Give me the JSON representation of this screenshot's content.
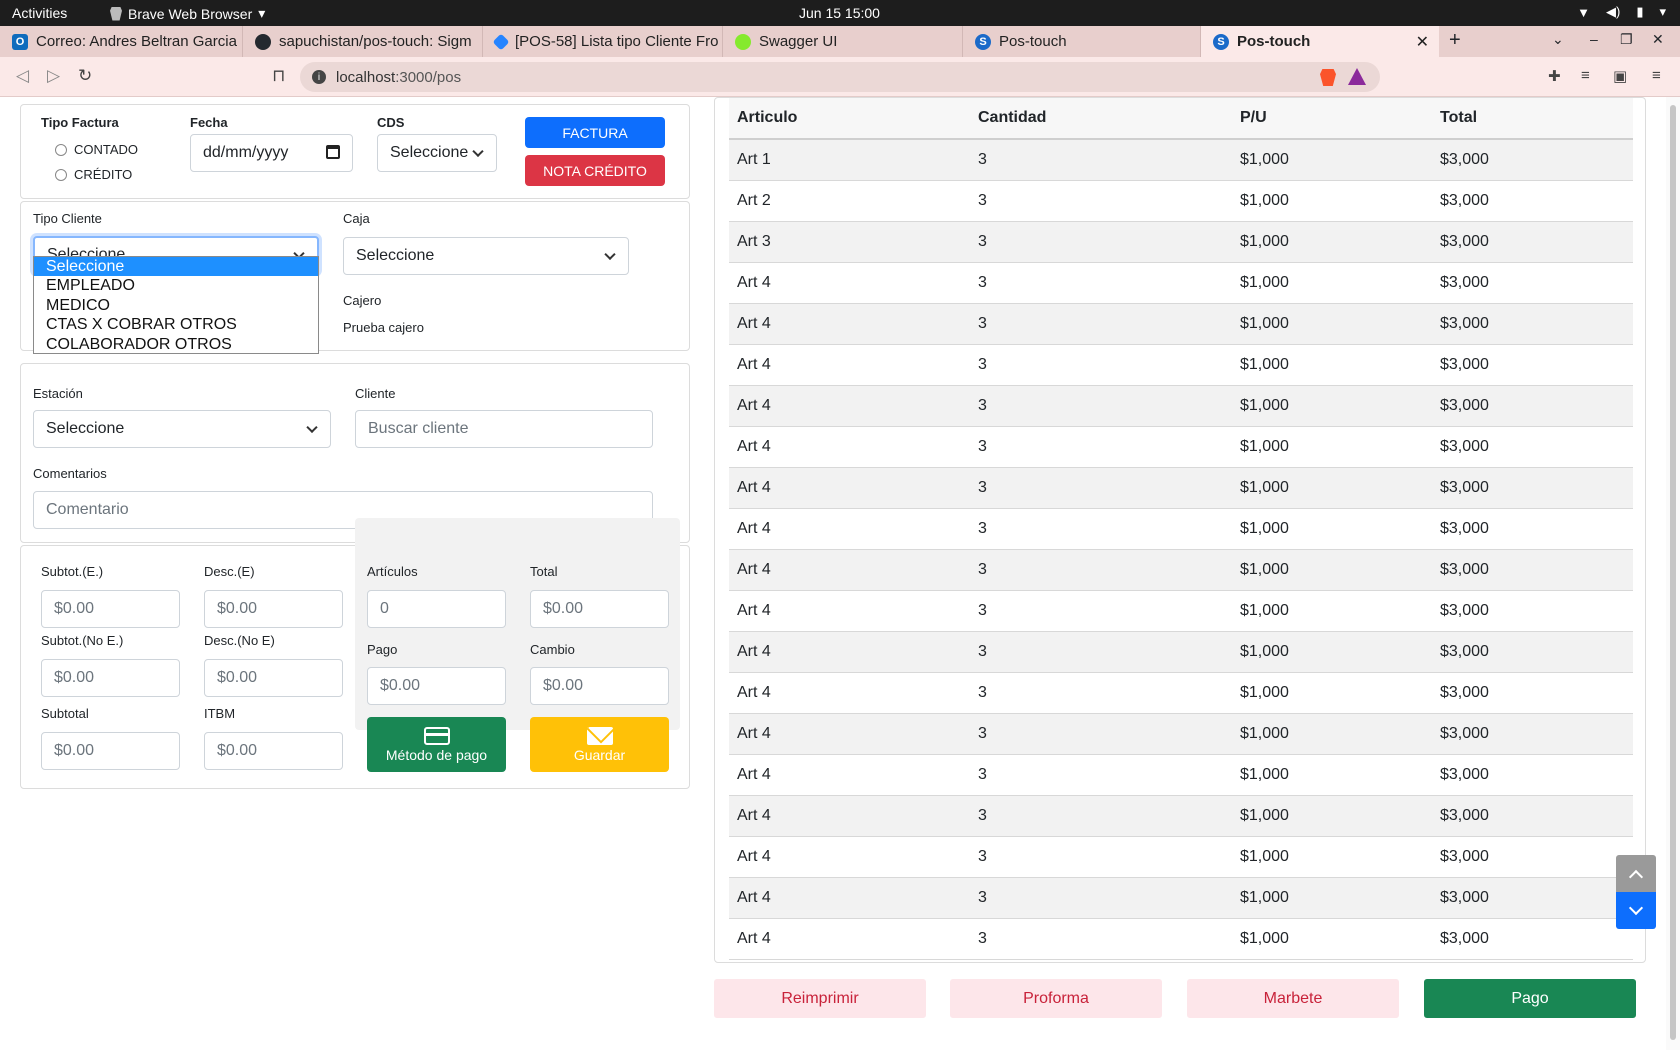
{
  "system": {
    "activities": "Activities",
    "app_name": "Brave Web Browser",
    "clock": "Jun 15  15:00"
  },
  "tabs": [
    {
      "label": "Correo: Andres Beltran Garcia",
      "favicon_color": "#0f6cbd"
    },
    {
      "label": "sapuchistan/pos-touch: Sigm",
      "favicon_color": "#24292f"
    },
    {
      "label": "[POS-58] Lista tipo Cliente Fro",
      "favicon_color": "#2684ff"
    },
    {
      "label": "Swagger UI",
      "favicon_color": "#85ea2d"
    },
    {
      "label": "Pos-touch",
      "favicon_color": "#1b6ac9"
    },
    {
      "label": "Pos-touch",
      "favicon_color": "#1b6ac9"
    }
  ],
  "address": {
    "host": "localhost",
    "path": ":3000/pos"
  },
  "factura_panel": {
    "tipo_factura_label": "Tipo Factura",
    "radio_contado": "CONTADO",
    "radio_credito": "CRÉDITO",
    "fecha_label": "Fecha",
    "fecha_placeholder": "dd/mm/yyyy",
    "cds_label": "CDS",
    "cds_value": "Seleccione",
    "btn_factura": "FACTURA",
    "btn_nota_credito": "NOTA CRÉDITO"
  },
  "cliente_panel": {
    "tipo_cliente_label": "Tipo Cliente",
    "tipo_cliente_value": "Seleccione",
    "tipo_cliente_options": [
      "Seleccione",
      "EMPLEADO",
      "MEDICO",
      "CTAS X COBRAR OTROS",
      "COLABORADOR OTROS"
    ],
    "caja_label": "Caja",
    "caja_value": "Seleccione",
    "cajero_label": "Cajero",
    "cajero_value": "Prueba cajero"
  },
  "estacion_panel": {
    "estacion_label": "Estación",
    "estacion_value": "Seleccione",
    "cliente_label": "Cliente",
    "cliente_placeholder": "Buscar cliente",
    "comentarios_label": "Comentarios",
    "comentario_placeholder": "Comentario"
  },
  "totals_panel": {
    "subtot_e_label": "Subtot.(E.)",
    "subtot_e_value": "$0.00",
    "desc_e_label": "Desc.(E)",
    "desc_e_value": "$0.00",
    "subtot_ne_label": "Subtot.(No E.)",
    "subtot_ne_value": "$0.00",
    "desc_ne_label": "Desc.(No E)",
    "desc_ne_value": "$0.00",
    "subtotal_label": "Subtotal",
    "subtotal_value": "$0.00",
    "itbm_label": "ITBM",
    "itbm_value": "$0.00",
    "articulos_label": "Artículos",
    "articulos_value": "0",
    "total_label": "Total",
    "total_value": "$0.00",
    "pago_label": "Pago",
    "pago_value": "$0.00",
    "cambio_label": "Cambio",
    "cambio_value": "$0.00",
    "btn_metodo_pago": "Método de pago",
    "btn_guardar": "Guardar"
  },
  "table": {
    "headers": [
      "Articulo",
      "Cantidad",
      "P/U",
      "Total"
    ],
    "rows": [
      [
        "Art 1",
        "3",
        "$1,000",
        "$3,000"
      ],
      [
        "Art 2",
        "3",
        "$1,000",
        "$3,000"
      ],
      [
        "Art 3",
        "3",
        "$1,000",
        "$3,000"
      ],
      [
        "Art 4",
        "3",
        "$1,000",
        "$3,000"
      ],
      [
        "Art 4",
        "3",
        "$1,000",
        "$3,000"
      ],
      [
        "Art 4",
        "3",
        "$1,000",
        "$3,000"
      ],
      [
        "Art 4",
        "3",
        "$1,000",
        "$3,000"
      ],
      [
        "Art 4",
        "3",
        "$1,000",
        "$3,000"
      ],
      [
        "Art 4",
        "3",
        "$1,000",
        "$3,000"
      ],
      [
        "Art 4",
        "3",
        "$1,000",
        "$3,000"
      ],
      [
        "Art 4",
        "3",
        "$1,000",
        "$3,000"
      ],
      [
        "Art 4",
        "3",
        "$1,000",
        "$3,000"
      ],
      [
        "Art 4",
        "3",
        "$1,000",
        "$3,000"
      ],
      [
        "Art 4",
        "3",
        "$1,000",
        "$3,000"
      ],
      [
        "Art 4",
        "3",
        "$1,000",
        "$3,000"
      ],
      [
        "Art 4",
        "3",
        "$1,000",
        "$3,000"
      ],
      [
        "Art 4",
        "3",
        "$1,000",
        "$3,000"
      ],
      [
        "Art 4",
        "3",
        "$1,000",
        "$3,000"
      ],
      [
        "Art 4",
        "3",
        "$1,000",
        "$3,000"
      ],
      [
        "Art 4",
        "3",
        "$1,000",
        "$3,000"
      ]
    ]
  },
  "actions": {
    "reimprimir": "Reimprimir",
    "proforma": "Proforma",
    "marbete": "Marbete",
    "pago": "Pago"
  },
  "colors": {
    "primary": "#0d6efd",
    "danger": "#dc3545",
    "success": "#198754",
    "warning": "#ffc107",
    "pink_bg": "#fde6ea"
  }
}
